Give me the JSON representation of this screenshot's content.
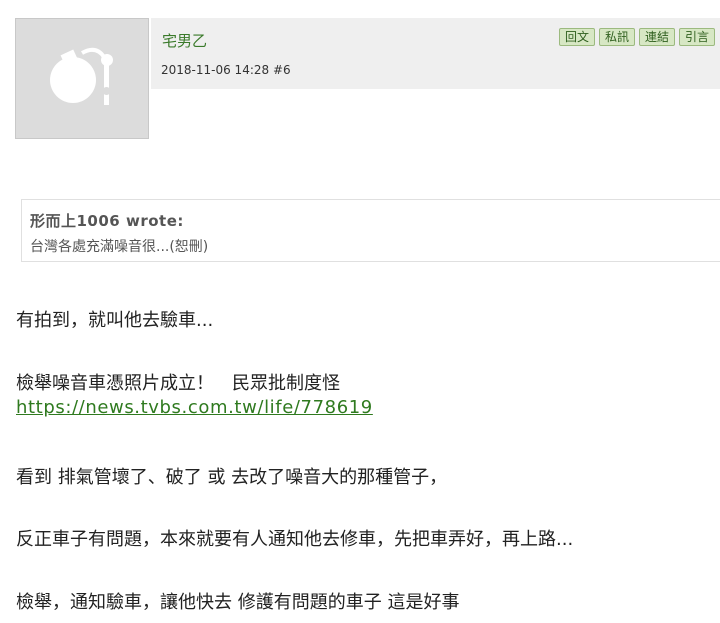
{
  "post": {
    "author": "宅男乙",
    "timestamp": "2018-11-06 14:28",
    "floor": "#6",
    "actions": [
      "回文",
      "私訊",
      "連結",
      "引言"
    ],
    "avatar_icon": "default-avatar-bomb-icon"
  },
  "quote": {
    "author": "形而上1006 wrote:",
    "text": "台灣各處充滿噪音很...(恕刪)"
  },
  "content": {
    "line1": "有拍到，就叫他去驗車...",
    "line2": "檢舉噪音車憑照片成立！　民眾批制度怪",
    "link": "https://news.tvbs.com.tw/life/778619",
    "line3": "看到 排氣管壞了、破了 或 去改了噪音大的那種管子，",
    "line4": "反正車子有問題，本來就要有人通知他去修車，先把車弄好，再上路...",
    "line5": "檢舉，通知驗車，讓他快去 修護有問題的車子 這是好事"
  },
  "colors": {
    "author": "#3a7a2a",
    "link": "#2f7a1f",
    "button_bg": "#d7e7c4",
    "header_bg": "#efefef"
  }
}
